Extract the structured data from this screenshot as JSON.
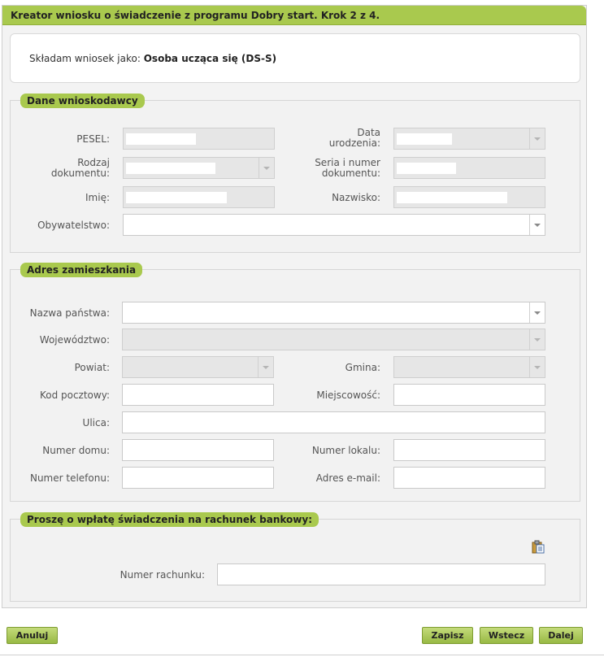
{
  "header": {
    "title": "Kreator wniosku o świadczenie z programu Dobry start. Krok 2 z 4."
  },
  "applicant": {
    "label": "Składam wniosek jako:",
    "value": "Osoba ucząca się (DS-S)"
  },
  "applicant_data": {
    "title": "Dane wnioskodawcy",
    "pesel_label": "PESEL:",
    "birth_date_label_1": "Data",
    "birth_date_label_2": "urodzenia:",
    "doc_type_label_1": "Rodzaj",
    "doc_type_label_2": "dokumentu:",
    "doc_number_label_1": "Seria i numer",
    "doc_number_label_2": "dokumentu:",
    "first_name_label": "Imię:",
    "last_name_label": "Nazwisko:",
    "citizenship_label": "Obywatelstwo:"
  },
  "address": {
    "title": "Adres zamieszkania",
    "country_label": "Nazwa państwa:",
    "voivodeship_label": "Województwo:",
    "county_label": "Powiat:",
    "commune_label": "Gmina:",
    "postal_code_label": "Kod pocztowy:",
    "city_label": "Miejscowość:",
    "street_label": "Ulica:",
    "house_number_label": "Numer domu:",
    "apartment_number_label": "Numer lokalu:",
    "phone_label": "Numer telefonu:",
    "email_label": "Adres e-mail:"
  },
  "bank": {
    "title": "Proszę o wpłatę świadczenia na rachunek bankowy:",
    "account_label": "Numer rachunku:"
  },
  "buttons": {
    "cancel": "Anuluj",
    "save": "Zapisz",
    "back": "Wstecz",
    "next": "Dalej"
  },
  "icons": {
    "paste": "clipboard-paste-icon"
  },
  "colors": {
    "accent": "#a9c94e",
    "button_border": "#7e9c32"
  }
}
